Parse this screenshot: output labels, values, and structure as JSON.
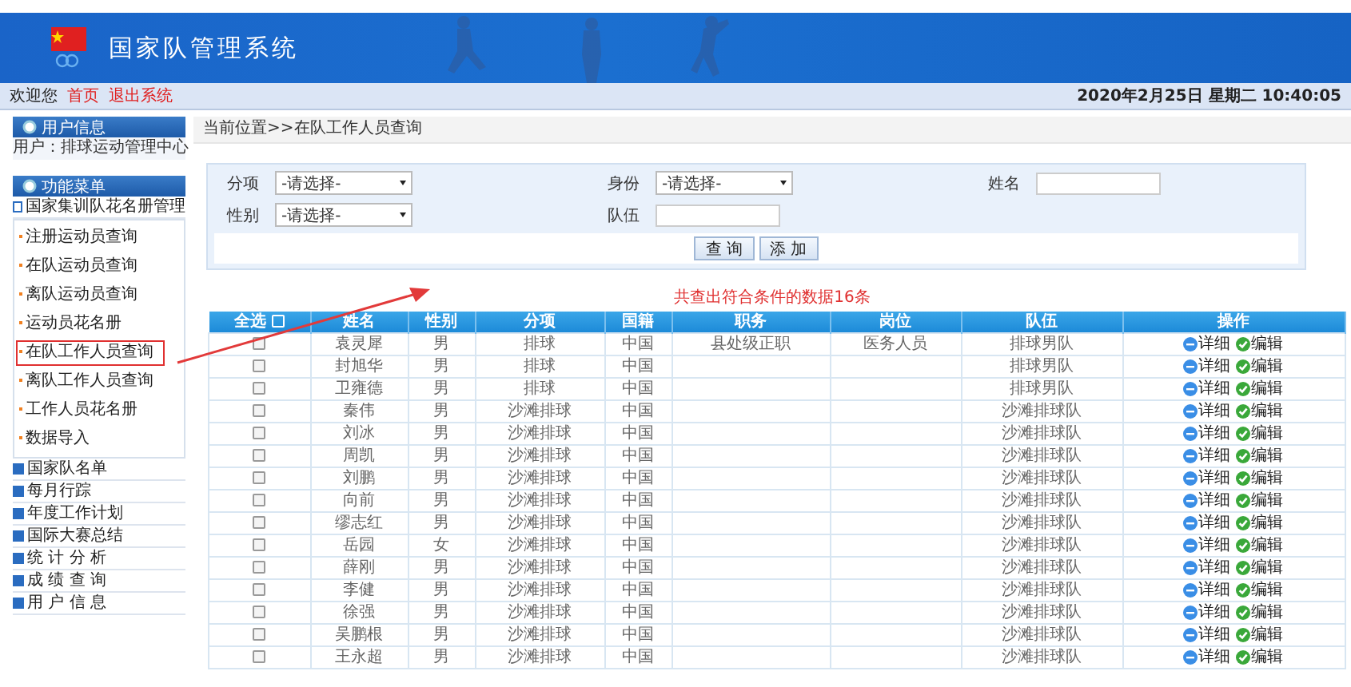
{
  "header": {
    "title": "国家队管理系统"
  },
  "nav": {
    "welcome": "欢迎您",
    "links": [
      "首页",
      "退出系统"
    ],
    "datetime": "2020年2月25日 星期二 10:40:05"
  },
  "sidebar": {
    "user_panel": {
      "title": "用户信息",
      "user": "用户：排球运动管理中心"
    },
    "menu_panel": {
      "title": "功能菜单",
      "groups": [
        {
          "label": "国家集训队花名册管理",
          "expanded": true,
          "children": [
            {
              "label": "注册运动员查询",
              "highlighted": false
            },
            {
              "label": "在队运动员查询",
              "highlighted": false
            },
            {
              "label": "离队运动员查询",
              "highlighted": false
            },
            {
              "label": "运动员花名册",
              "highlighted": false
            },
            {
              "label": "在队工作人员查询",
              "highlighted": true
            },
            {
              "label": "离队工作人员查询",
              "highlighted": false
            },
            {
              "label": "工作人员花名册",
              "highlighted": false
            },
            {
              "label": "数据导入",
              "highlighted": false
            }
          ]
        },
        {
          "label": "国家队名单",
          "expanded": false
        },
        {
          "label": "每月行踪",
          "expanded": false
        },
        {
          "label": "年度工作计划",
          "expanded": false
        },
        {
          "label": "国际大赛总结",
          "expanded": false
        },
        {
          "label": "统 计 分 析",
          "expanded": false
        },
        {
          "label": "成 绩 查 询",
          "expanded": false
        },
        {
          "label": "用 户 信 息",
          "expanded": false
        }
      ]
    }
  },
  "breadcrumb": "当前位置>>在队工作人员查询",
  "search": {
    "fields": [
      {
        "kind": "select",
        "label": "分项",
        "value": "-请选择-"
      },
      {
        "kind": "select",
        "label": "身份",
        "value": "-请选择-"
      },
      {
        "kind": "input",
        "label": "姓名"
      },
      {
        "kind": "select",
        "label": "性别",
        "value": "-请选择-"
      },
      {
        "kind": "input",
        "label": "队伍"
      }
    ],
    "buttons": [
      "查 询",
      "添 加"
    ]
  },
  "result_count": "共查出符合条件的数据16条",
  "annotation": {
    "arrow": true
  },
  "table": {
    "select_all": {
      "label": "全选",
      "checked": false
    },
    "columns": [
      "姓名",
      "性别",
      "分项",
      "国籍",
      "职务",
      "岗位",
      "队伍",
      "操作"
    ],
    "rows": [
      {
        "checked": false,
        "cells": [
          "袁灵犀",
          "男",
          "排球",
          "中国",
          "县处级正职",
          "医务人员",
          "排球男队"
        ],
        "actions": [
          "详细",
          "编辑"
        ]
      },
      {
        "checked": false,
        "cells": [
          "封旭华",
          "男",
          "排球",
          "中国",
          "",
          "",
          "排球男队"
        ],
        "actions": [
          "详细",
          "编辑"
        ]
      },
      {
        "checked": false,
        "cells": [
          "卫雍德",
          "男",
          "排球",
          "中国",
          "",
          "",
          "排球男队"
        ],
        "actions": [
          "详细",
          "编辑"
        ]
      },
      {
        "checked": false,
        "cells": [
          "秦伟",
          "男",
          "沙滩排球",
          "中国",
          "",
          "",
          "沙滩排球队"
        ],
        "actions": [
          "详细",
          "编辑"
        ]
      },
      {
        "checked": false,
        "cells": [
          "刘冰",
          "男",
          "沙滩排球",
          "中国",
          "",
          "",
          "沙滩排球队"
        ],
        "actions": [
          "详细",
          "编辑"
        ]
      },
      {
        "checked": false,
        "cells": [
          "周凯",
          "男",
          "沙滩排球",
          "中国",
          "",
          "",
          "沙滩排球队"
        ],
        "actions": [
          "详细",
          "编辑"
        ]
      },
      {
        "checked": false,
        "cells": [
          "刘鹏",
          "男",
          "沙滩排球",
          "中国",
          "",
          "",
          "沙滩排球队"
        ],
        "actions": [
          "详细",
          "编辑"
        ]
      },
      {
        "checked": false,
        "cells": [
          "向前",
          "男",
          "沙滩排球",
          "中国",
          "",
          "",
          "沙滩排球队"
        ],
        "actions": [
          "详细",
          "编辑"
        ]
      },
      {
        "checked": false,
        "cells": [
          "缪志红",
          "男",
          "沙滩排球",
          "中国",
          "",
          "",
          "沙滩排球队"
        ],
        "actions": [
          "详细",
          "编辑"
        ]
      },
      {
        "checked": false,
        "cells": [
          "岳园",
          "女",
          "沙滩排球",
          "中国",
          "",
          "",
          "沙滩排球队"
        ],
        "actions": [
          "详细",
          "编辑"
        ]
      },
      {
        "checked": false,
        "cells": [
          "薛刚",
          "男",
          "沙滩排球",
          "中国",
          "",
          "",
          "沙滩排球队"
        ],
        "actions": [
          "详细",
          "编辑"
        ]
      },
      {
        "checked": false,
        "cells": [
          "李健",
          "男",
          "沙滩排球",
          "中国",
          "",
          "",
          "沙滩排球队"
        ],
        "actions": [
          "详细",
          "编辑"
        ]
      },
      {
        "checked": false,
        "cells": [
          "徐强",
          "男",
          "沙滩排球",
          "中国",
          "",
          "",
          "沙滩排球队"
        ],
        "actions": [
          "详细",
          "编辑"
        ]
      },
      {
        "checked": false,
        "cells": [
          "吴鹏根",
          "男",
          "沙滩排球",
          "中国",
          "",
          "",
          "沙滩排球队"
        ],
        "actions": [
          "详细",
          "编辑"
        ]
      },
      {
        "checked": false,
        "cells": [
          "王永超",
          "男",
          "沙滩排球",
          "中国",
          "",
          "",
          "沙滩排球队"
        ],
        "actions": [
          "详细",
          "编辑"
        ]
      }
    ]
  }
}
